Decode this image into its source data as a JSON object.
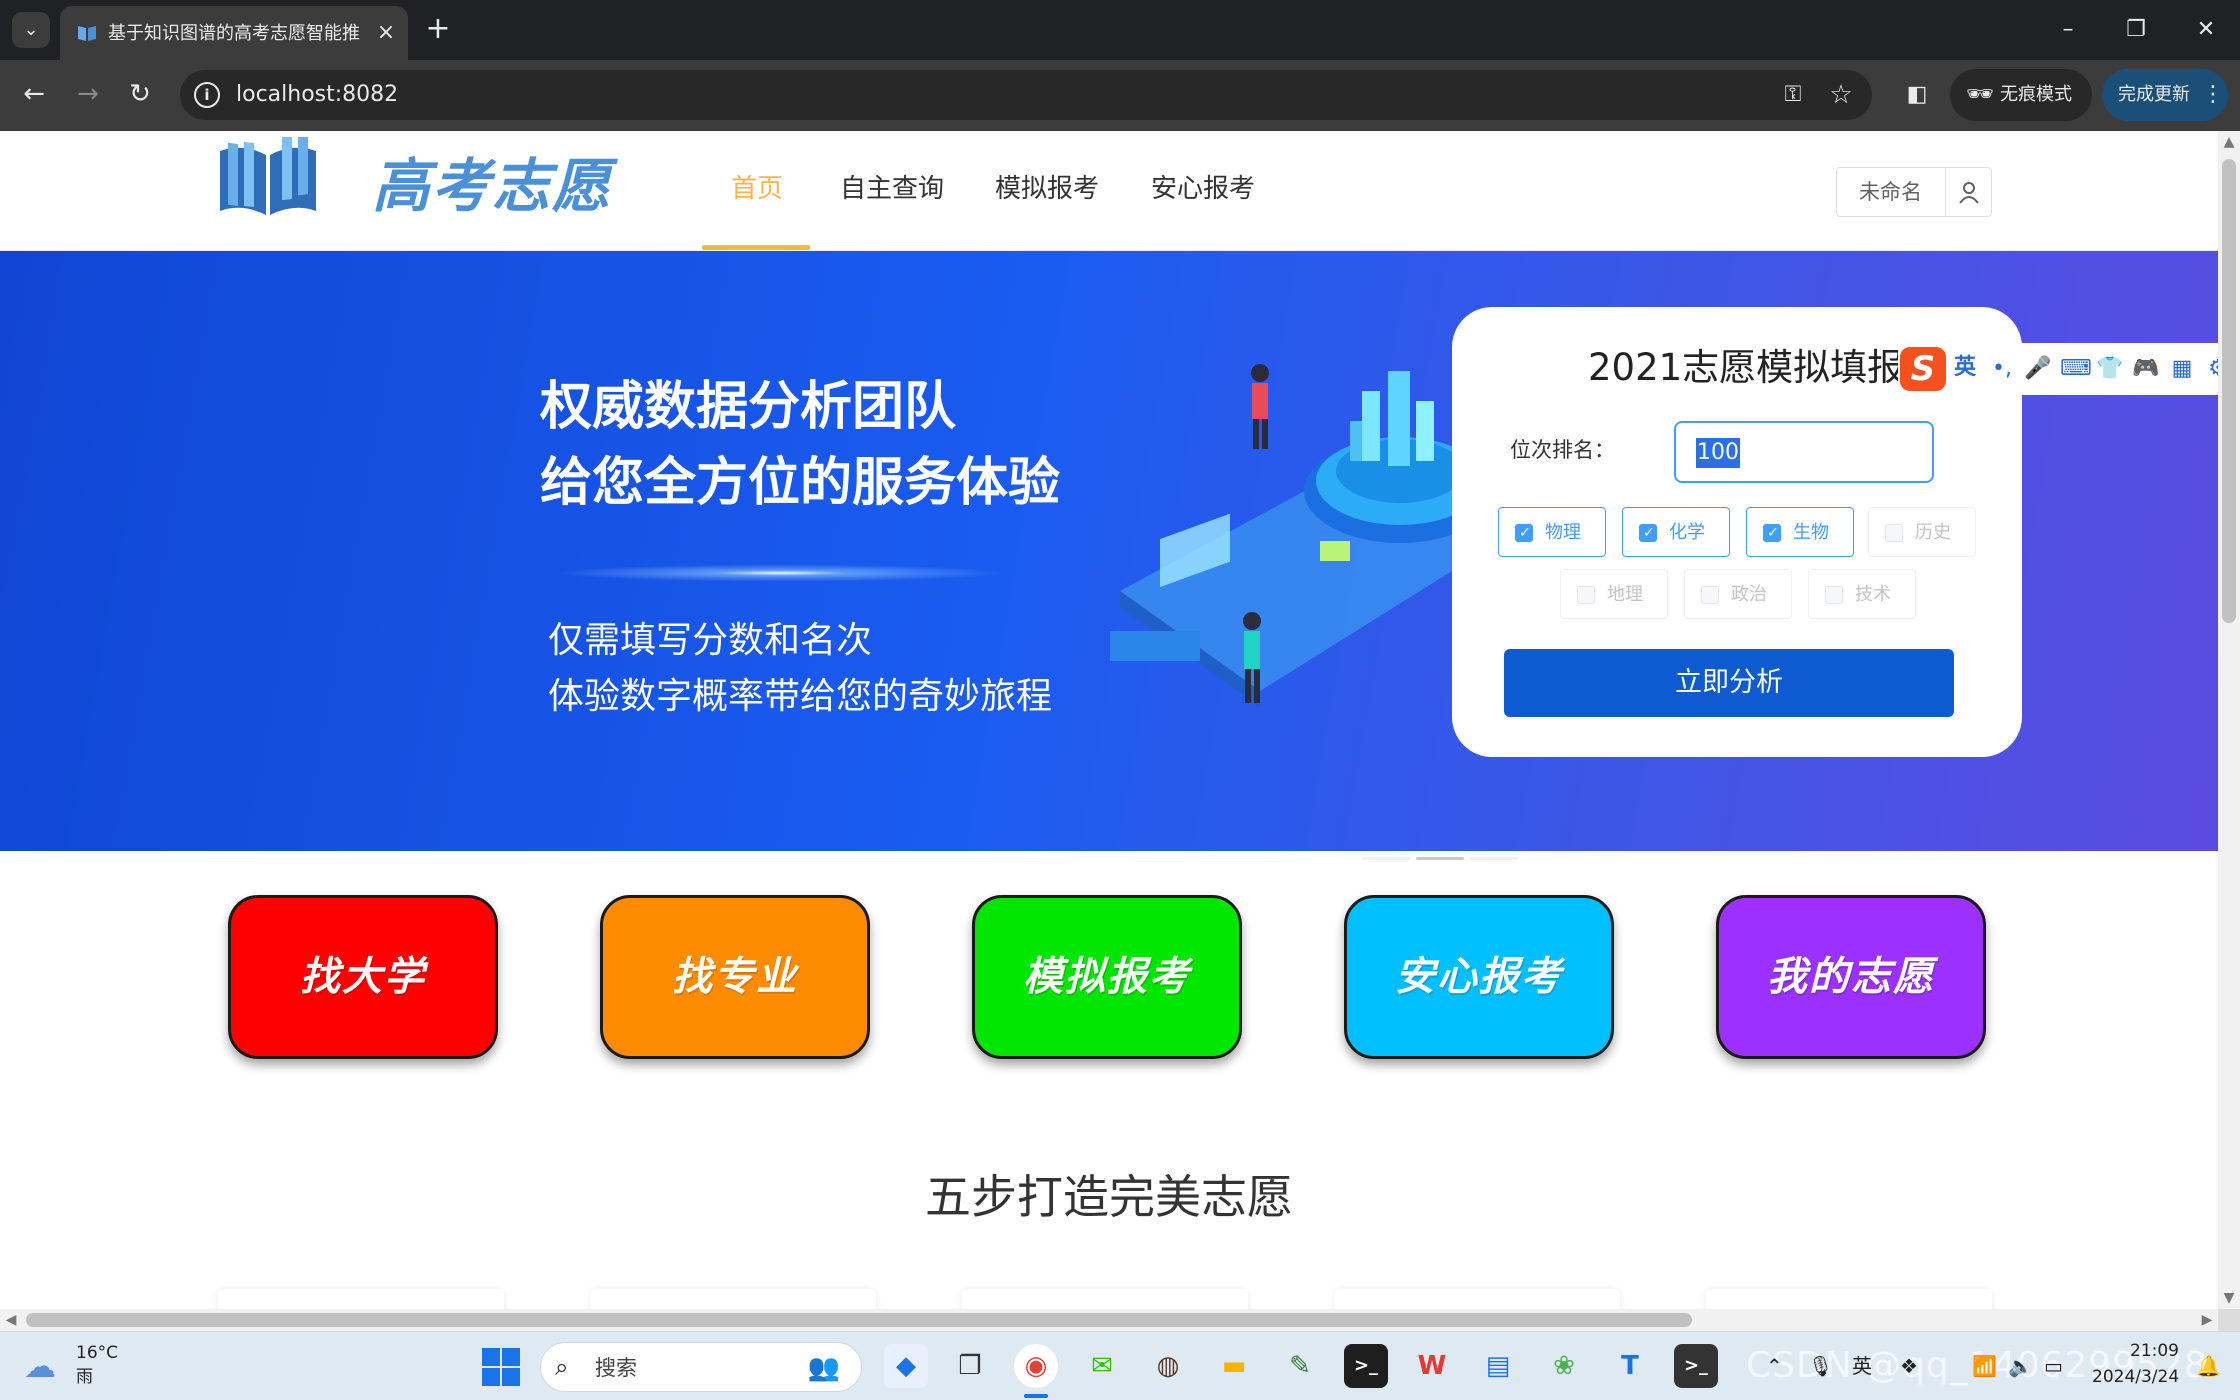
{
  "browser": {
    "tab_title": "基于知识图谱的高考志愿智能推",
    "url": "localhost:8082",
    "incognito_label": "无痕模式",
    "update_label": "完成更新"
  },
  "header": {
    "logo_text": "高考志愿",
    "nav": [
      "首页",
      "自主查询",
      "模拟报考",
      "安心报考"
    ],
    "active_nav": "首页",
    "user_name": "未命名"
  },
  "banner": {
    "headline_1": "权威数据分析团队",
    "headline_2": "给您全方位的服务体验",
    "sub_1": "仅需填写分数和名次",
    "sub_2": "体验数字概率带给您的奇妙旅程"
  },
  "simulation": {
    "title": "2021志愿模拟填报",
    "rank_label": "位次排名：",
    "rank_value": "100",
    "subjects": [
      {
        "label": "物理",
        "checked": true,
        "disabled": false
      },
      {
        "label": "化学",
        "checked": true,
        "disabled": false
      },
      {
        "label": "生物",
        "checked": true,
        "disabled": false
      },
      {
        "label": "历史",
        "checked": false,
        "disabled": true
      },
      {
        "label": "地理",
        "checked": false,
        "disabled": true
      },
      {
        "label": "政治",
        "checked": false,
        "disabled": true
      },
      {
        "label": "技术",
        "checked": false,
        "disabled": true
      }
    ],
    "analyze_label": "立即分析"
  },
  "ime": {
    "mode_label": "英"
  },
  "features": [
    {
      "label": "找大学",
      "color": "#ff0000"
    },
    {
      "label": "找专业",
      "color": "#ff8c00"
    },
    {
      "label": "模拟报考",
      "color": "#00e600"
    },
    {
      "label": "安心报考",
      "color": "#00bfff"
    },
    {
      "label": "我的志愿",
      "color": "#9b30ff"
    }
  ],
  "steps_title": "五步打造完美志愿",
  "taskbar": {
    "temperature": "16°C",
    "condition": "雨",
    "search_label": "搜索",
    "time": "21:09",
    "date": "2024/3/24",
    "ime_label": "英",
    "watermark": "CSDN @qq_1406299528"
  }
}
